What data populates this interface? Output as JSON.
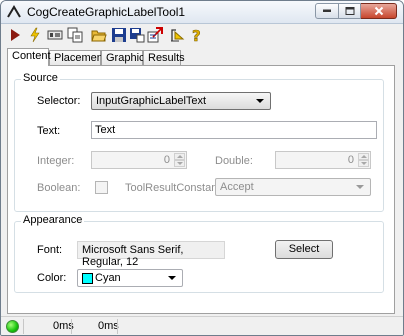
{
  "window": {
    "title": "CogCreateGraphicLabelTool1"
  },
  "toolbar": {
    "icons": [
      "run-icon",
      "electric-run-icon",
      "reset-icon",
      "copy-icon",
      "open-icon",
      "save-icon",
      "save-as-icon",
      "import-icon",
      "pin-icon",
      "help-icon"
    ]
  },
  "tabs": [
    {
      "label": "Content",
      "active": true
    },
    {
      "label": "Placement",
      "active": false
    },
    {
      "label": "Graphics",
      "active": false
    },
    {
      "label": "Results",
      "active": false
    }
  ],
  "source": {
    "group_label": "Source",
    "selector_label": "Selector:",
    "selector_value": "InputGraphicLabelText",
    "text_label": "Text:",
    "text_value": "Text",
    "integer_label": "Integer:",
    "integer_value": "0",
    "double_label": "Double:",
    "double_value": "0",
    "boolean_label": "Boolean:",
    "tool_result_label": "ToolResultConstant:",
    "tool_result_value": "Accept"
  },
  "appearance": {
    "group_label": "Appearance",
    "font_label": "Font:",
    "font_value": "Microsoft Sans Serif, Regular, 12",
    "select_button": "Select",
    "color_label": "Color:",
    "color_value": "Cyan",
    "color_swatch": "#00ffff"
  },
  "status": {
    "time1": "0ms",
    "time2": "0ms",
    "indicator_color": "#17c40b"
  }
}
